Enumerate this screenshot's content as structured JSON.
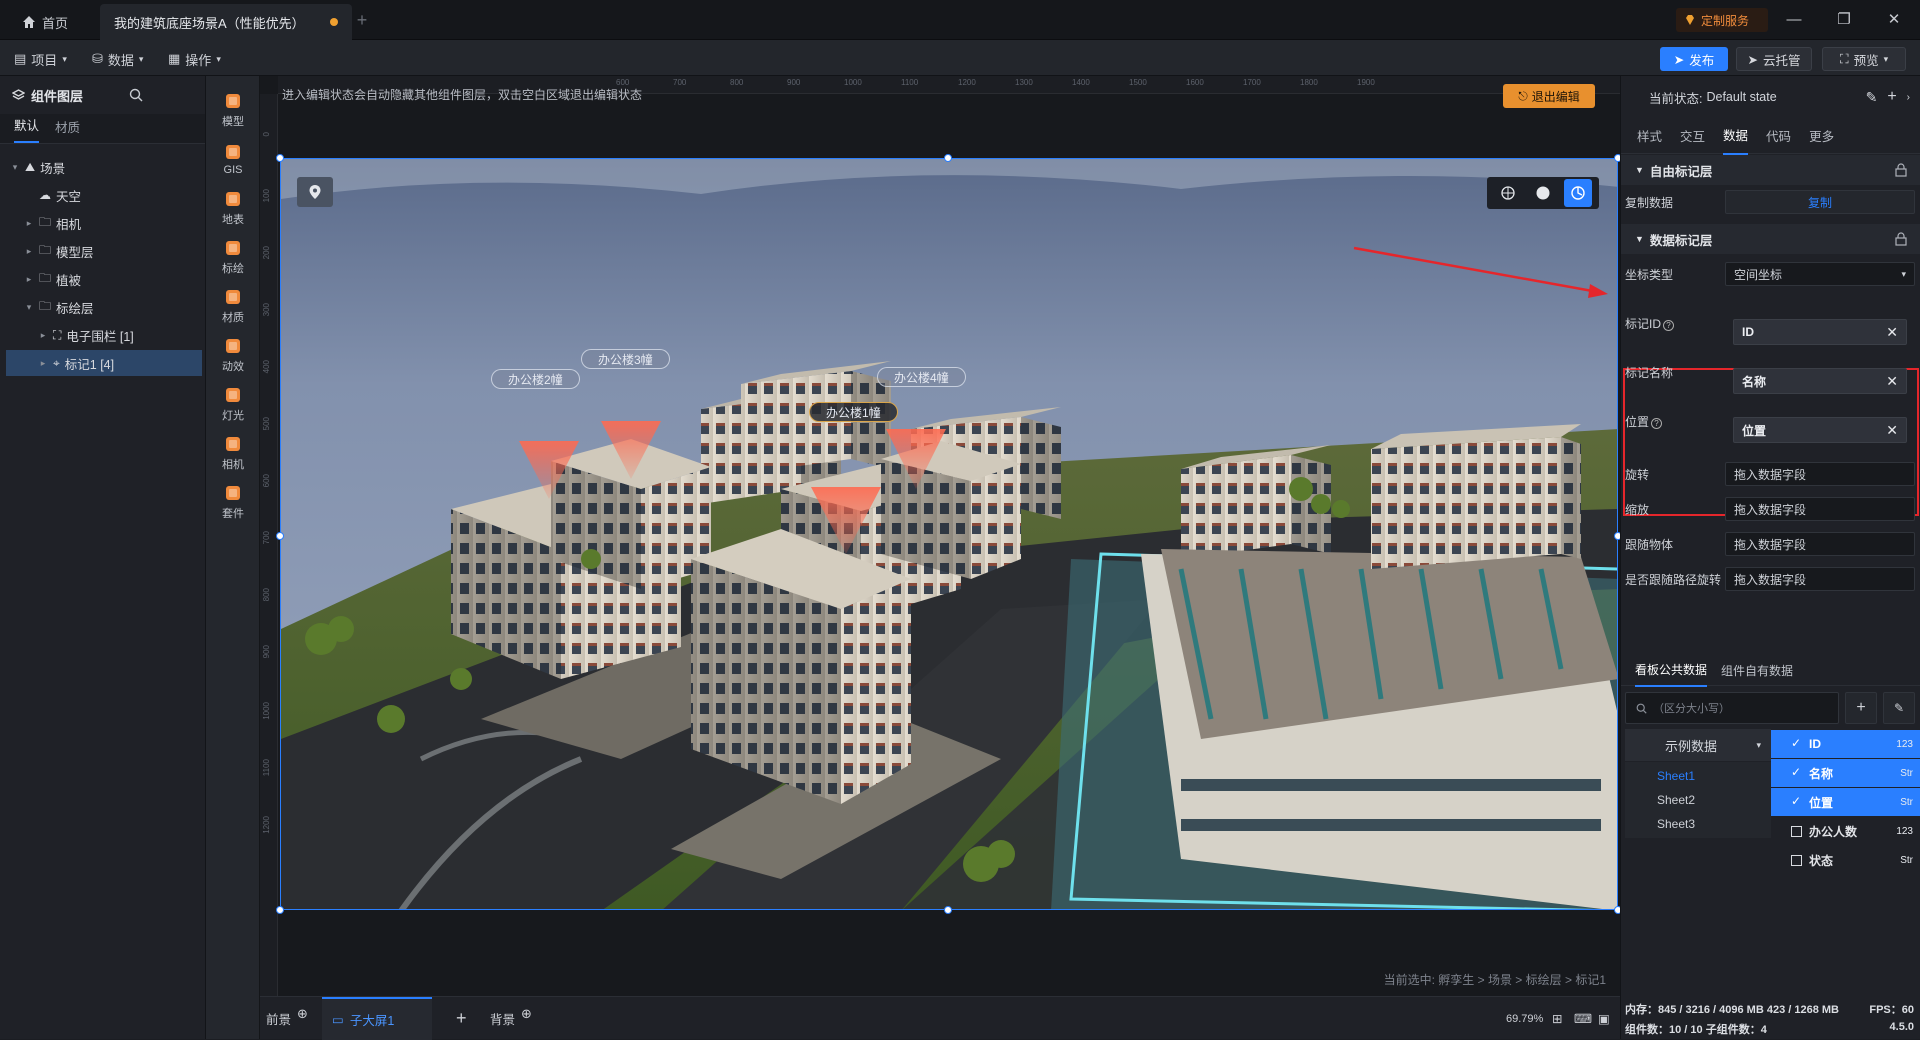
{
  "titlebar": {
    "home_tab": "首页",
    "active_tab": "我的建筑底座场景A（性能优先）",
    "custom_service": "定制服务"
  },
  "menubar": {
    "project": "项目",
    "data": "数据",
    "operate": "操作",
    "publish": "发布",
    "cloud_host": "云托管",
    "preview": "预览"
  },
  "layers": {
    "title": "组件图层",
    "tabs": [
      "默认",
      "材质"
    ],
    "tree": [
      {
        "label": "场景",
        "indent": 0,
        "caret": "▾",
        "icon": "scene-icon"
      },
      {
        "label": "天空",
        "indent": 1,
        "caret": "",
        "icon": "sky-icon"
      },
      {
        "label": "相机",
        "indent": 1,
        "caret": "▸",
        "icon": "folder-icon"
      },
      {
        "label": "模型层",
        "indent": 1,
        "caret": "▸",
        "icon": "folder-icon"
      },
      {
        "label": "植被",
        "indent": 1,
        "caret": "▸",
        "icon": "folder-icon"
      },
      {
        "label": "标绘层",
        "indent": 1,
        "caret": "▾",
        "icon": "folder-icon"
      },
      {
        "label": "电子围栏 [1]",
        "indent": 2,
        "caret": "▸",
        "icon": "fence-icon"
      },
      {
        "label": "标记1 [4]",
        "indent": 2,
        "caret": "▸",
        "icon": "marker-icon",
        "selected": true
      }
    ]
  },
  "toolbox": [
    {
      "label": "模型",
      "color": "#f08a3c"
    },
    {
      "label": "GIS",
      "color": "#f08a3c"
    },
    {
      "label": "地表",
      "color": "#f08a3c"
    },
    {
      "label": "标绘",
      "color": "#f08a3c"
    },
    {
      "label": "材质",
      "color": "#f08a3c"
    },
    {
      "label": "动效",
      "color": "#f08a3c"
    },
    {
      "label": "灯光",
      "color": "#f08a3c"
    },
    {
      "label": "相机",
      "color": "#f08a3c"
    },
    {
      "label": "套件",
      "color": "#f08a3c"
    }
  ],
  "canvas": {
    "hint": "进入编辑状态会自动隐藏其他组件图层，双击空白区域退出编辑状态",
    "exit_edit": "退出编辑",
    "ruler_top": [
      "600",
      "700",
      "800",
      "900",
      "1000",
      "1100",
      "1200",
      "1300",
      "1400",
      "1500",
      "1600",
      "1700",
      "1800",
      "1900"
    ],
    "ruler_left": [
      "0",
      "100",
      "200",
      "300",
      "400",
      "500",
      "600",
      "700",
      "800",
      "900",
      "1000",
      "1100",
      "1200"
    ],
    "markers": [
      "办公楼1幢",
      "办公楼2幢",
      "办公楼3幢",
      "办公楼4幢"
    ],
    "path": "当前选中: 孵孪生 > 场景 > 标绘层 > 标记1"
  },
  "bottombar": {
    "front": "前景",
    "sub_screen": "子大屏1",
    "background": "背景",
    "zoom": "69.79%"
  },
  "props": {
    "state_label": "当前状态:",
    "state_value": "Default state",
    "tabs": [
      "样式",
      "交互",
      "数据",
      "代码",
      "更多"
    ],
    "active_tab": "数据",
    "free_layer": "自由标记层",
    "copy_data_label": "复制数据",
    "copy_btn": "复制",
    "data_layer": "数据标记层",
    "coord_type_label": "坐标类型",
    "coord_type_value": "空间坐标",
    "marker_id_label": "标记ID",
    "marker_id_value": "ID",
    "marker_name_label": "标记名称",
    "marker_name_value": "名称",
    "position_label": "位置",
    "position_value": "位置",
    "drag_hint": "拖入数据字段",
    "rotation_label": "旋转",
    "scale_label": "缩放",
    "follow_label": "跟随物体",
    "follow_rot_label": "是否跟随路径旋转",
    "data_tabs": [
      "看板公共数据",
      "组件自有数据"
    ],
    "search_placeholder": "（区分大小写）",
    "dataset": "示例数据",
    "sheets": [
      "Sheet1",
      "Sheet2",
      "Sheet3"
    ],
    "fields": [
      {
        "name": "ID",
        "type": "123",
        "checked": true
      },
      {
        "name": "名称",
        "type": "Str",
        "checked": true
      },
      {
        "name": "位置",
        "type": "Str",
        "checked": true
      },
      {
        "name": "办公人数",
        "type": "123",
        "checked": false
      },
      {
        "name": "状态",
        "type": "Str",
        "checked": false
      }
    ],
    "stats": {
      "memory": "内存：845 / 3216 / 4096 MB   423 / 1268 MB",
      "fps": "FPS：60",
      "components": "组件数：10 / 10   子组件数：4",
      "version": "4.5.0"
    }
  }
}
